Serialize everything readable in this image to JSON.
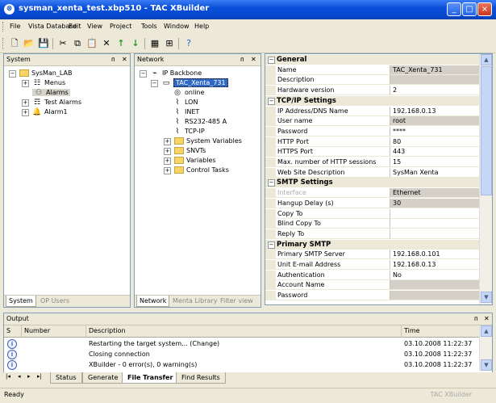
{
  "window": {
    "title": "sysman_xenta_test.xbp510 - TAC XBuilder",
    "min": "_",
    "max": "□",
    "close": "×"
  },
  "menu": [
    "File",
    "Vista Database",
    "Edit",
    "View",
    "Project",
    "Tools",
    "Window",
    "Help"
  ],
  "system_pane": {
    "title": "System",
    "tree": [
      {
        "label": "SysMan_LAB",
        "level": 0,
        "icon": "folder-icon",
        "exp": "−"
      },
      {
        "label": "Menus",
        "level": 1,
        "icon": "menus-icon",
        "exp": "+"
      },
      {
        "label": "Alarms",
        "level": 1,
        "icon": "alarms-icon",
        "exp": "",
        "state": "highlight"
      },
      {
        "label": "Test Alarms",
        "level": 1,
        "icon": "test-alarms-icon",
        "exp": "+"
      },
      {
        "label": "Alarm1",
        "level": 1,
        "icon": "alarm1-icon",
        "exp": "+"
      }
    ],
    "tabs": [
      "System",
      "OP Users"
    ]
  },
  "network_pane": {
    "title": "Network",
    "tree": [
      {
        "label": "IP Backbone",
        "level": 0,
        "icon": "network-icon",
        "exp": "−"
      },
      {
        "label": "TAC_Xenta_731",
        "level": 1,
        "icon": "device-icon",
        "exp": "−",
        "state": "selected"
      },
      {
        "label": "online",
        "level": 2,
        "icon": "online-icon",
        "exp": ""
      },
      {
        "label": "LON",
        "level": 2,
        "icon": "port-icon",
        "exp": ""
      },
      {
        "label": "INET",
        "level": 2,
        "icon": "port-icon",
        "exp": ""
      },
      {
        "label": "RS232-485 A",
        "level": 2,
        "icon": "port-icon",
        "exp": ""
      },
      {
        "label": "TCP-IP",
        "level": 2,
        "icon": "port-icon",
        "exp": ""
      },
      {
        "label": "System Variables",
        "level": 2,
        "icon": "folder-icon",
        "exp": "+"
      },
      {
        "label": "SNVTs",
        "level": 2,
        "icon": "folder-icon",
        "exp": "+"
      },
      {
        "label": "Variables",
        "level": 2,
        "icon": "folder-icon",
        "exp": "+"
      },
      {
        "label": "Control Tasks",
        "level": 2,
        "icon": "folder-icon",
        "exp": "+"
      }
    ],
    "tabs": [
      "Network",
      "Menta Library",
      "Filter view"
    ]
  },
  "properties": [
    {
      "cat": "General"
    },
    {
      "name": "Name",
      "value": "TAC_Xenta_731",
      "ro": true
    },
    {
      "name": "Description",
      "value": "",
      "ro": true
    },
    {
      "name": "Hardware version",
      "value": "2",
      "ro": false
    },
    {
      "cat": "TCP/IP Settings"
    },
    {
      "name": "IP Address/DNS Name",
      "value": "192.168.0.13",
      "ro": false
    },
    {
      "name": "User name",
      "value": "root",
      "ro": true
    },
    {
      "name": "Password",
      "value": "****",
      "ro": false
    },
    {
      "name": "HTTP Port",
      "value": "80",
      "ro": false
    },
    {
      "name": "HTTPS Port",
      "value": "443",
      "ro": false
    },
    {
      "name": "Max. number of HTTP sessions",
      "value": "15",
      "ro": false
    },
    {
      "name": "Web Site Description",
      "value": "SysMan Xenta",
      "ro": false
    },
    {
      "cat": "SMTP Settings"
    },
    {
      "name": "Interface",
      "value": "Ethernet",
      "ro": true,
      "disabled": true
    },
    {
      "name": "Hangup Delay (s)",
      "value": "30",
      "ro": true
    },
    {
      "name": "Copy To",
      "value": "",
      "ro": false
    },
    {
      "name": "Blind Copy To",
      "value": "",
      "ro": false
    },
    {
      "name": "Reply To",
      "value": "",
      "ro": false
    },
    {
      "cat": "Primary SMTP"
    },
    {
      "name": "Primary SMTP Server",
      "value": "192.168.0.101",
      "ro": false
    },
    {
      "name": "Unit E-mail Address",
      "value": "192.168.0.13",
      "ro": false
    },
    {
      "name": "Authentication",
      "value": "No",
      "ro": false
    },
    {
      "name": "Account Name",
      "value": "",
      "ro": true
    },
    {
      "name": "Password",
      "value": "",
      "ro": true
    }
  ],
  "output": {
    "title": "Output",
    "columns": {
      "s": "S",
      "number": "Number",
      "description": "Description",
      "time": "Time"
    },
    "rows": [
      {
        "description": "Restarting the target system... (Change)",
        "time": "03.10.2008 11:22:37"
      },
      {
        "description": "Closing connection",
        "time": "03.10.2008 11:22:37"
      },
      {
        "description": "XBuilder - 0 error(s), 0 warning(s)",
        "time": "03.10.2008 11:22:37"
      }
    ],
    "tabs": [
      "Status",
      "Generate",
      "File Transfer",
      "Find Results"
    ],
    "nav": [
      "|◂",
      "◂",
      "▸",
      "▸|"
    ]
  },
  "status": {
    "text": "Ready",
    "product": "TAC XBuilder"
  }
}
